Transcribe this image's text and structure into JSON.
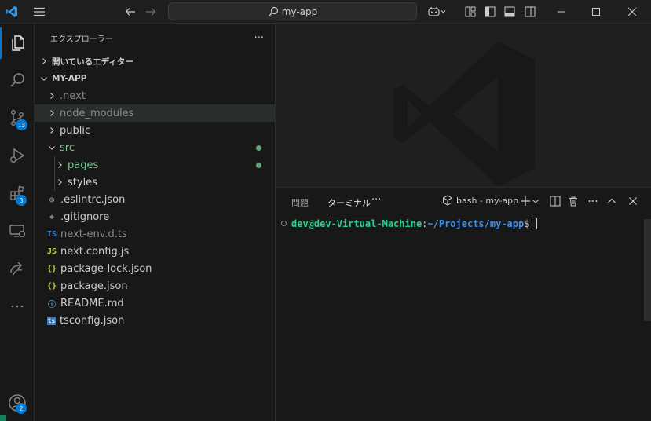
{
  "titlebar": {
    "search_text": "my-app",
    "icons": [
      "vscode-logo-icon",
      "menu-icon",
      "back-arrow-icon",
      "forward-arrow-icon",
      "search-icon",
      "copilot-icon",
      "layout-icon",
      "toggle-sidebar-icon",
      "toggle-panel-icon",
      "toggle-secondary-sidebar-icon",
      "minimize-icon",
      "maximize-icon",
      "close-icon"
    ]
  },
  "activity_bar": {
    "items": [
      {
        "name": "explorer-icon",
        "badge": ""
      },
      {
        "name": "search-icon",
        "badge": ""
      },
      {
        "name": "source-control-icon",
        "badge": "13"
      },
      {
        "name": "run-debug-icon",
        "badge": ""
      },
      {
        "name": "extensions-icon",
        "badge": "3"
      },
      {
        "name": "remote-explorer-icon",
        "badge": ""
      },
      {
        "name": "remote-share-icon",
        "badge": ""
      },
      {
        "name": "more-icon",
        "badge": ""
      }
    ],
    "account_badge": "2"
  },
  "sidebar": {
    "title": "エクスプローラー",
    "more": "···",
    "open_editors": "開いているエディター",
    "project": "MY-APP",
    "tree": [
      {
        "label": ".next",
        "type": "folder",
        "level": 0,
        "style": "dim",
        "expanded": false
      },
      {
        "label": "node_modules",
        "type": "folder",
        "level": 0,
        "style": "dim",
        "expanded": false
      },
      {
        "label": "public",
        "type": "folder",
        "level": 0,
        "style": "normal",
        "expanded": false
      },
      {
        "label": "src",
        "type": "folder",
        "level": 0,
        "style": "green",
        "expanded": true
      },
      {
        "label": "pages",
        "type": "folder",
        "level": 1,
        "style": "green",
        "expanded": false
      },
      {
        "label": "styles",
        "type": "folder",
        "level": 1,
        "style": "normal",
        "expanded": false
      },
      {
        "label": ".eslintrc.json",
        "type": "file",
        "icon": "◎",
        "level": 0,
        "style": "normal"
      },
      {
        "label": ".gitignore",
        "type": "file",
        "icon": "◆",
        "level": 0,
        "style": "normal"
      },
      {
        "label": "next-env.d.ts",
        "type": "file",
        "icon": "TS",
        "level": 0,
        "style": "dim"
      },
      {
        "label": "next.config.js",
        "type": "file",
        "icon": "JS",
        "level": 0,
        "style": "normal"
      },
      {
        "label": "package-lock.json",
        "type": "file",
        "icon": "{}",
        "level": 0,
        "style": "normal"
      },
      {
        "label": "package.json",
        "type": "file",
        "icon": "{}",
        "level": 0,
        "style": "normal"
      },
      {
        "label": "README.md",
        "type": "file",
        "icon": "ⓘ",
        "level": 0,
        "style": "normal"
      },
      {
        "label": "tsconfig.json",
        "type": "file",
        "icon": "ts",
        "level": 0,
        "style": "normal"
      }
    ]
  },
  "panel": {
    "tabs": [
      "問題",
      "ターミナル"
    ],
    "more": "···",
    "terminal_name": "bash - my-app",
    "prompt_user": "dev@dev-Virtual-Machine",
    "prompt_sep": ":",
    "prompt_path": "~/Projects/my-app",
    "prompt_symbol": "$"
  },
  "colors": {
    "accent": "#0078d4",
    "git_modified": "#73c991",
    "prompt_user": "#23d18b",
    "prompt_path": "#3b8eea"
  }
}
